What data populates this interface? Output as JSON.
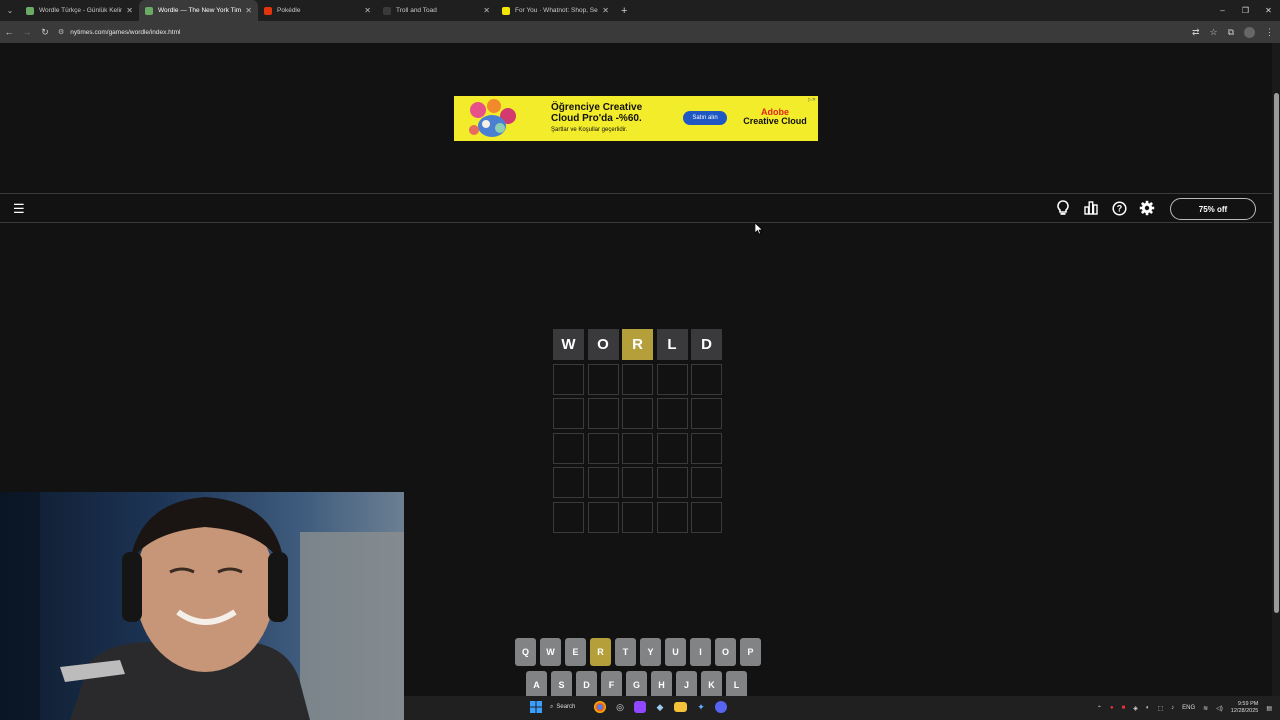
{
  "browser": {
    "tabs": [
      {
        "title": "Wordle Türkçe - Günlük Kelime",
        "favicon_color": "#6aaa64",
        "active": false
      },
      {
        "title": "Wordle — The New York Times",
        "favicon_color": "#6aaa64",
        "active": true
      },
      {
        "title": "Pokédle",
        "favicon_color": "#e3350d",
        "active": false
      },
      {
        "title": "Troll and Toad",
        "favicon_color": "#3a3a3a",
        "active": false
      },
      {
        "title": "For You · Whatnot: Shop, Sell, C",
        "favicon_color": "#f2e600",
        "active": false
      }
    ],
    "url": "nytimes.com/games/wordle/index.html"
  },
  "ad": {
    "headline": "Öğrenciye Creative Cloud Pro'da -%60.",
    "subline": "Şartlar ve Koşullar geçerlidir.",
    "button": "Satın alın",
    "brand_top": "Adobe",
    "brand_bottom": "Creative Cloud",
    "background": "#f3ec2a"
  },
  "header": {
    "icons": [
      "lightbulb-icon",
      "stats-icon",
      "help-icon",
      "settings-icon"
    ],
    "offer_button": "75% off"
  },
  "board": {
    "rows": [
      [
        {
          "letter": "W",
          "state": "absent"
        },
        {
          "letter": "O",
          "state": "absent"
        },
        {
          "letter": "R",
          "state": "present"
        },
        {
          "letter": "L",
          "state": "absent"
        },
        {
          "letter": "D",
          "state": "absent"
        }
      ],
      [
        {
          "letter": "",
          "state": "empty"
        },
        {
          "letter": "",
          "state": "empty"
        },
        {
          "letter": "",
          "state": "empty"
        },
        {
          "letter": "",
          "state": "empty"
        },
        {
          "letter": "",
          "state": "empty"
        }
      ],
      [
        {
          "letter": "",
          "state": "empty"
        },
        {
          "letter": "",
          "state": "empty"
        },
        {
          "letter": "",
          "state": "empty"
        },
        {
          "letter": "",
          "state": "empty"
        },
        {
          "letter": "",
          "state": "empty"
        }
      ],
      [
        {
          "letter": "",
          "state": "empty"
        },
        {
          "letter": "",
          "state": "empty"
        },
        {
          "letter": "",
          "state": "empty"
        },
        {
          "letter": "",
          "state": "empty"
        },
        {
          "letter": "",
          "state": "empty"
        }
      ],
      [
        {
          "letter": "",
          "state": "empty"
        },
        {
          "letter": "",
          "state": "empty"
        },
        {
          "letter": "",
          "state": "empty"
        },
        {
          "letter": "",
          "state": "empty"
        },
        {
          "letter": "",
          "state": "empty"
        }
      ],
      [
        {
          "letter": "",
          "state": "empty"
        },
        {
          "letter": "",
          "state": "empty"
        },
        {
          "letter": "",
          "state": "empty"
        },
        {
          "letter": "",
          "state": "empty"
        },
        {
          "letter": "",
          "state": "empty"
        }
      ]
    ],
    "colors": {
      "present": "#b59f3b",
      "absent": "#3a3a3c"
    }
  },
  "keyboard": {
    "row1": [
      {
        "key": "Q",
        "state": "unused"
      },
      {
        "key": "W",
        "state": "unused"
      },
      {
        "key": "E",
        "state": "unused"
      },
      {
        "key": "R",
        "state": "present"
      },
      {
        "key": "T",
        "state": "unused"
      },
      {
        "key": "Y",
        "state": "unused"
      },
      {
        "key": "U",
        "state": "unused"
      },
      {
        "key": "I",
        "state": "unused"
      },
      {
        "key": "O",
        "state": "unused"
      },
      {
        "key": "P",
        "state": "unused"
      }
    ],
    "row2": [
      {
        "key": "A",
        "state": "unused"
      },
      {
        "key": "S",
        "state": "unused"
      },
      {
        "key": "D",
        "state": "unused"
      },
      {
        "key": "F",
        "state": "unused"
      },
      {
        "key": "G",
        "state": "unused"
      },
      {
        "key": "H",
        "state": "unused"
      },
      {
        "key": "J",
        "state": "unused"
      },
      {
        "key": "K",
        "state": "unused"
      },
      {
        "key": "L",
        "state": "unused"
      }
    ]
  },
  "taskbar": {
    "search_label": "Search",
    "lang": "ENG",
    "time": "9:59 PM",
    "date": "12/28/2025"
  }
}
